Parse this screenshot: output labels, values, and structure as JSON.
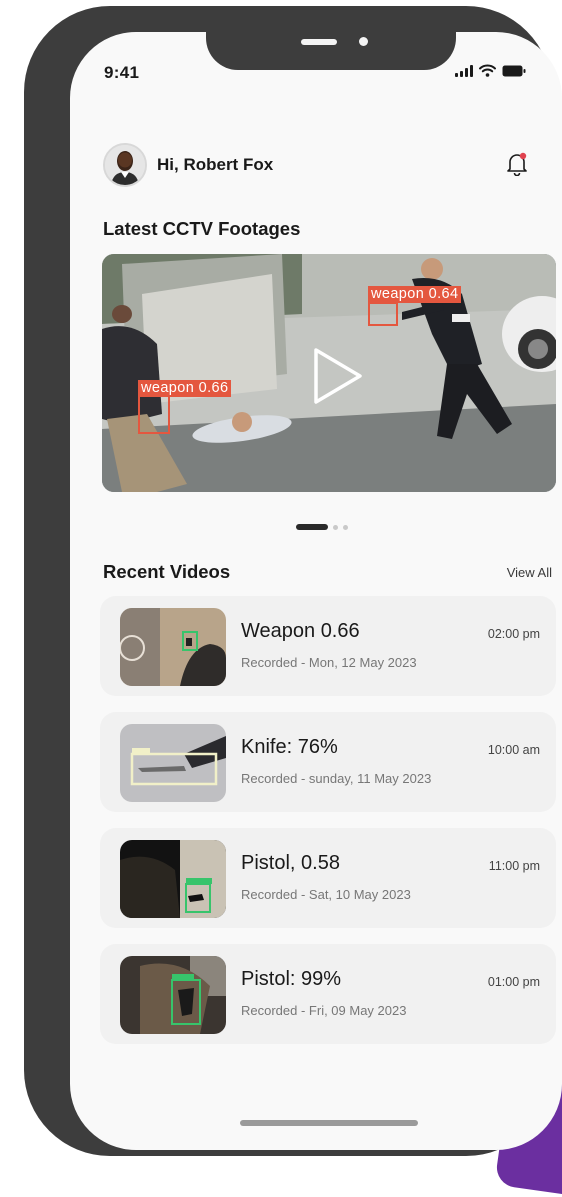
{
  "status_bar": {
    "time": "9:41"
  },
  "header": {
    "greeting": "Hi, Robert Fox"
  },
  "latest": {
    "title": "Latest CCTV Footages",
    "detections": [
      {
        "label": "weapon 0.66"
      },
      {
        "label": "weapon 0.64"
      }
    ],
    "carousel_pages": 3,
    "carousel_active": 1
  },
  "recent": {
    "title": "Recent Videos",
    "view_all": "View All",
    "items": [
      {
        "title": "Weapon 0.66",
        "recorded": "Recorded - Mon, 12 May 2023",
        "time": "02:00 pm"
      },
      {
        "title": "Knife: 76%",
        "recorded": "Recorded - sunday, 11 May 2023",
        "time": "10:00 am"
      },
      {
        "title": "Pistol, 0.58",
        "recorded": "Recorded - Sat, 10 May 2023",
        "time": "11:00 pm"
      },
      {
        "title": "Pistol: 99%",
        "recorded": "Recorded - Fri, 09 May 2023",
        "time": "01:00 pm"
      }
    ]
  },
  "icons": [
    "signal-icon",
    "wifi-icon",
    "battery-icon",
    "bell-icon",
    "play-icon"
  ],
  "colors": {
    "detection": "#e4573f",
    "detection_green": "#37c46b",
    "accent_notification": "#e0424f"
  }
}
